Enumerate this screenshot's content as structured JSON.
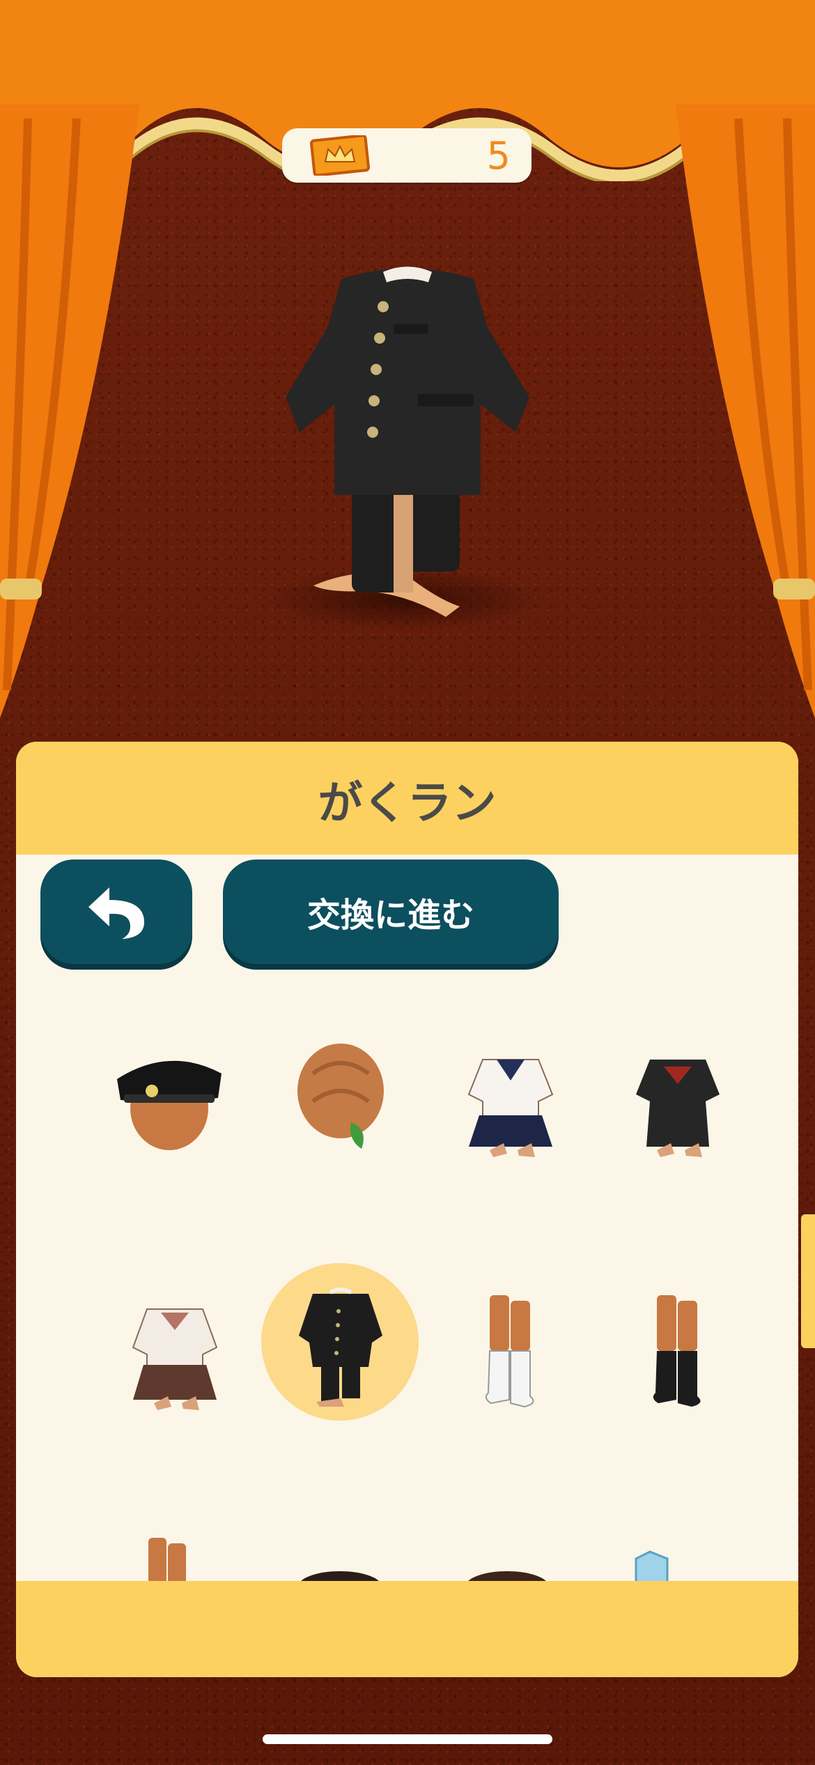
{
  "ticket": {
    "icon": "ticket-crown-icon",
    "count": "5"
  },
  "preview": {
    "item": "gakuran-uniform",
    "icon": "mannequin-gakuran-icon"
  },
  "panel": {
    "title": "がくラン"
  },
  "items": [
    {
      "name": "school-cap-icon"
    },
    {
      "name": "hair-bun-icon"
    },
    {
      "name": "sailor-uniform-white-icon"
    },
    {
      "name": "sailor-uniform-black-icon"
    },
    {
      "name": "sailor-uniform-brown-icon"
    },
    {
      "name": "gakuran-icon",
      "selected": true
    },
    {
      "name": "white-socks-icon"
    },
    {
      "name": "black-socks-icon"
    },
    {
      "name": "item-partial-1-icon"
    },
    {
      "name": "item-partial-2-icon"
    },
    {
      "name": "item-partial-3-icon"
    },
    {
      "name": "item-partial-4-icon"
    }
  ],
  "buttons": {
    "back_icon": "undo-arrow-icon",
    "proceed_label": "交換に進む"
  },
  "colors": {
    "accent": "#fdd15f",
    "button": "#0c4f5e",
    "ticket_count": "#ef8a1f",
    "curtain": "#ee7d10"
  }
}
